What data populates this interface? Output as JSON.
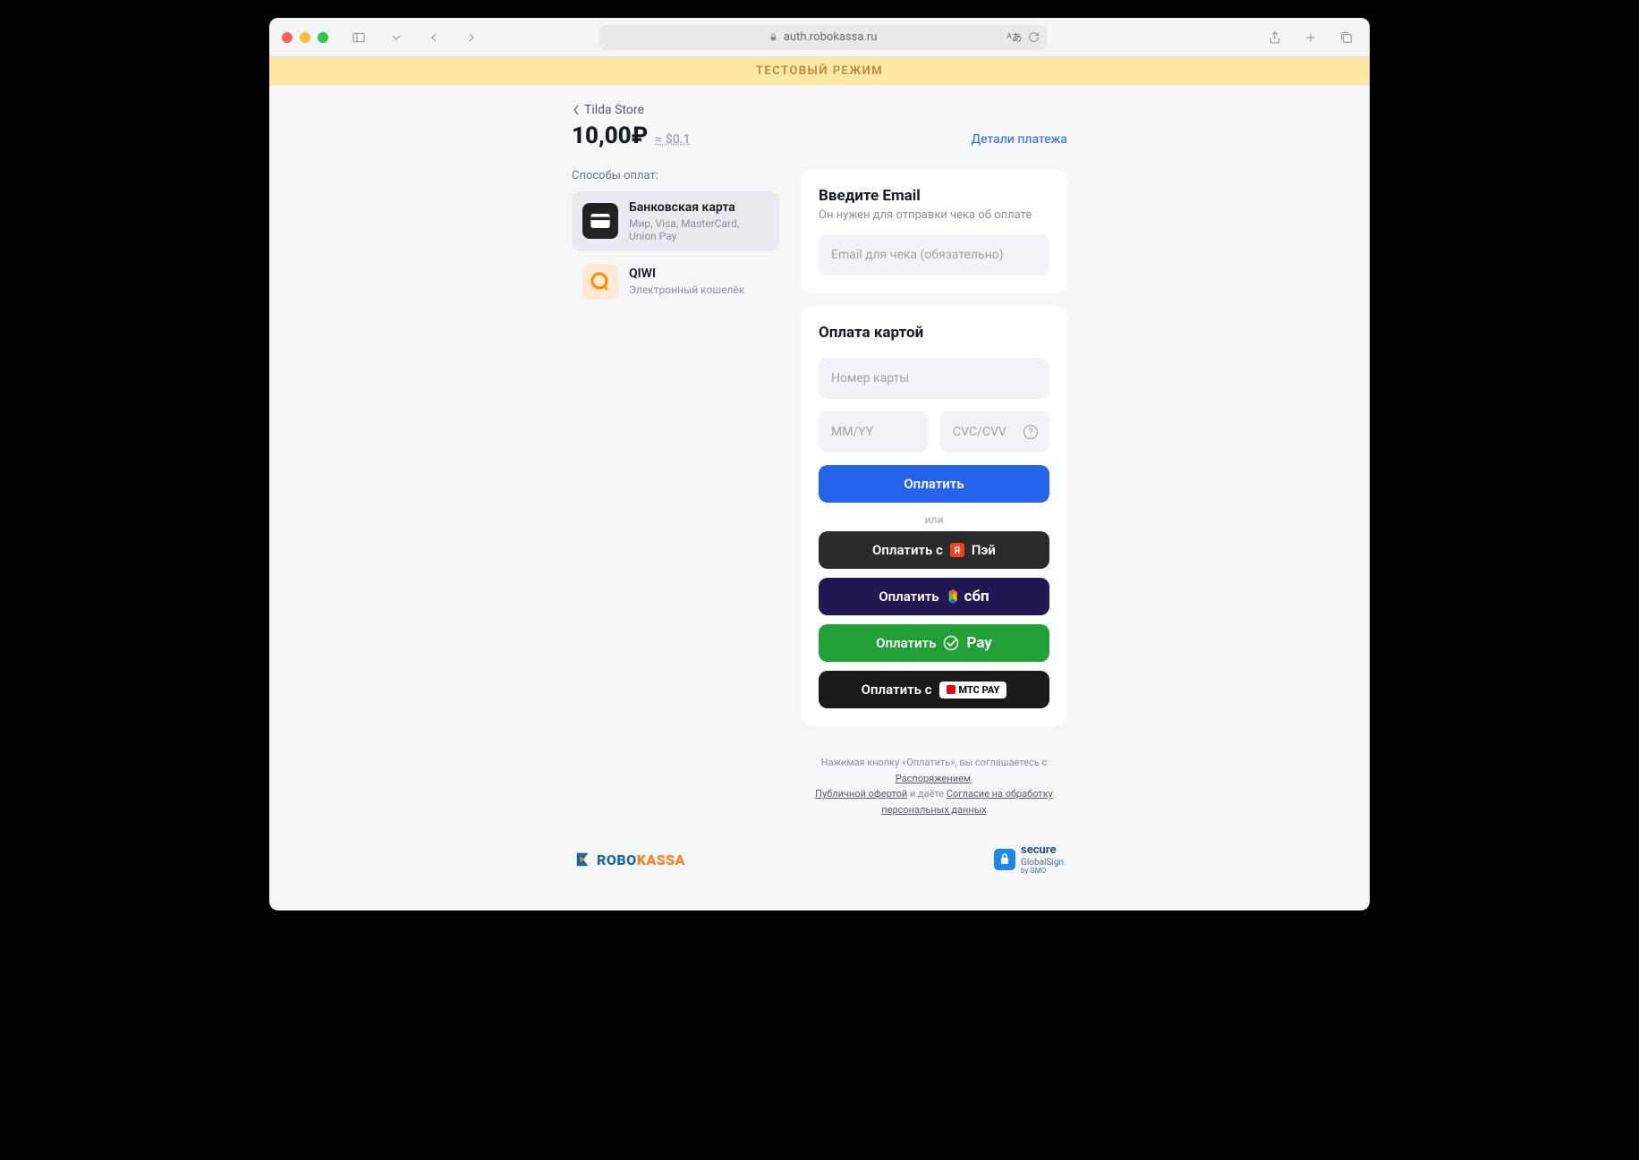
{
  "browser": {
    "url": "auth.robokassa.ru"
  },
  "banner": "ТЕСТОВЫЙ РЕЖИМ",
  "back_label": "Tilda Store",
  "price": "10,00₽",
  "price_approx": "≈ $0.1",
  "details_link": "Детали платежа",
  "methods_title": "Способы оплат:",
  "methods": [
    {
      "label": "Банковская карта",
      "sub": "Мир, Visa, MasterCard, Union Pay"
    },
    {
      "label": "QIWI",
      "sub": "Электронный кошелёк"
    }
  ],
  "email": {
    "title": "Введите Email",
    "sub": "Он нужен для отправки чека об оплате",
    "placeholder": "Email для чека (обязательно)"
  },
  "card": {
    "title": "Оплата картой",
    "number_ph": "Номер карты",
    "exp_ph": "MM/YY",
    "cvc_ph": "CVC/CVV"
  },
  "buttons": {
    "pay": "Оплатить",
    "or": "или",
    "yapay_prefix": "Оплатить с",
    "yapay_label": "Пэй",
    "sbp": "Оплатить",
    "sbp_brand": "сбп",
    "sber": "Оплатить",
    "sber_brand": "Pay",
    "mts_prefix": "Оплатить с",
    "mts_brand": "МТС PAY"
  },
  "legal": {
    "t1": "Нажимая кнопку «Оплатить», вы соглашаетесь с ",
    "l1": "Распоряжением",
    "t2": ", ",
    "l2": "Публичной офертой",
    "t3": " и даёте ",
    "l3": "Согласие на обработку персональных данных"
  },
  "footer": {
    "brand": "ROBOKASSA",
    "secure": "secure",
    "secure2": "GlobalSign",
    "secure3": "by GMO"
  }
}
